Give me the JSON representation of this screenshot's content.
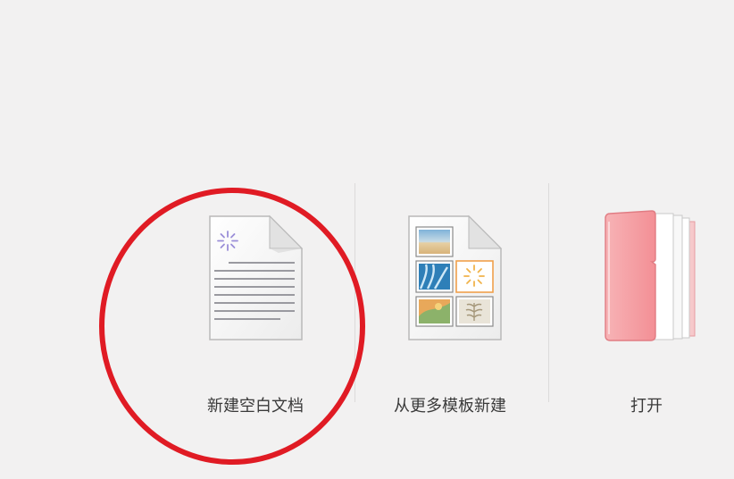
{
  "actions": [
    {
      "id": "new-blank",
      "label": "新建空白文档",
      "icon": "blank-document-icon"
    },
    {
      "id": "from-template",
      "label": "从更多模板新建",
      "icon": "template-document-icon"
    },
    {
      "id": "open",
      "label": "打开",
      "icon": "pink-folder-icon"
    }
  ],
  "colors": {
    "background": "#f2f1f1",
    "annotation_circle": "#e01b24",
    "folder": "#f4a3a7"
  }
}
